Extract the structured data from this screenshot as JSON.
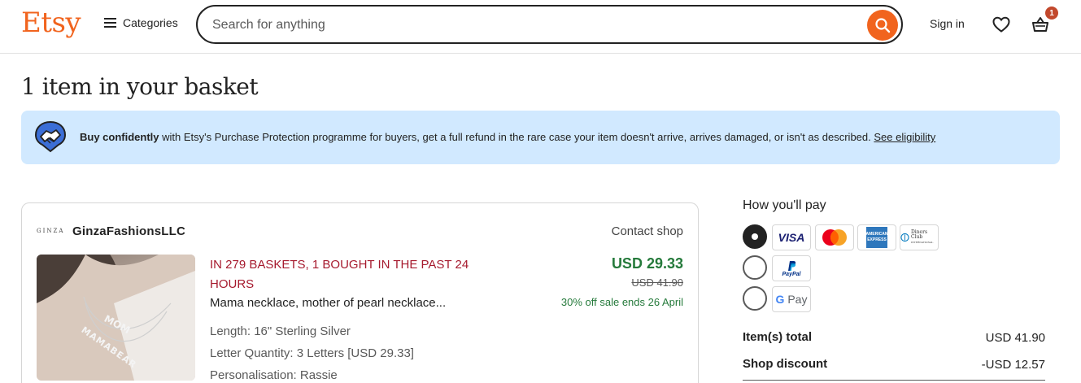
{
  "header": {
    "logo": "Etsy",
    "categories_label": "Categories",
    "search_placeholder": "Search for anything",
    "signin_label": "Sign in",
    "basket_count": "1"
  },
  "page": {
    "title": "1 item in your basket"
  },
  "banner": {
    "bold": "Buy confidently",
    "text": " with Etsy's Purchase Protection programme for buyers, get a full refund in the rare case your item doesn't arrive, arrives damaged, or isn't as described. ",
    "link": "See eligibility"
  },
  "shop": {
    "logo_text": "GINZA",
    "name": "GinzaFashionsLLC",
    "contact_label": "Contact shop",
    "item": {
      "hype": "IN 279 BASKETS, 1 BOUGHT IN THE PAST 24 HOURS",
      "title": "Mama necklace, mother of pearl necklace...",
      "variants": [
        "Length: 16\" Sterling Silver",
        "Letter Quantity: 3 Letters [USD 29.33]",
        "Personalisation: Rassie"
      ],
      "image_letters_top": "MOM",
      "image_letters_bottom": "MAMABEAR",
      "price": "USD 29.33",
      "original_price": "USD 41.90",
      "sale_text": "30% off sale ends 26 April"
    }
  },
  "payment": {
    "title": "How you'll pay",
    "methods": [
      {
        "selected": true,
        "cards": [
          "VISA",
          "Mastercard",
          "AMERICAN EXPRESS",
          "Diners Club INTERNATIONAL"
        ]
      },
      {
        "selected": false,
        "cards": [
          "PayPal"
        ]
      },
      {
        "selected": false,
        "cards": [
          "G Pay"
        ]
      }
    ],
    "labels": {
      "visa": "VISA",
      "amex_top": "AMERICAN",
      "amex_bottom": "EXPRESS",
      "diners_top": "Diners Club",
      "diners_bottom": "INTERNATIONAL",
      "paypal": "PayPal",
      "gpay_g": "G",
      "gpay_text": "Pay"
    }
  },
  "summary": {
    "items_total_label": "Item(s) total",
    "items_total_value": "USD 41.90",
    "shop_discount_label": "Shop discount",
    "shop_discount_value": "-USD 12.57"
  },
  "colors": {
    "brand": "#f1641e",
    "banner_bg": "#d1e9ff",
    "price_green": "#257a3b",
    "hype_red": "#a61a2e",
    "badge": "#c2482c"
  }
}
